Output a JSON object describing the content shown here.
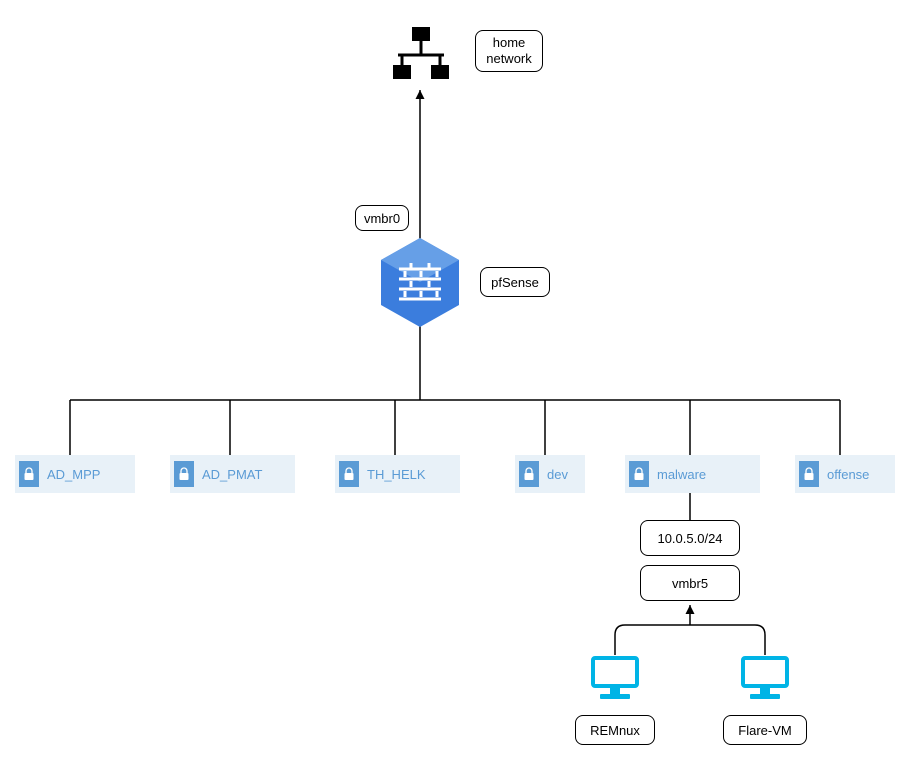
{
  "top": {
    "home_network": "home\nnetwork",
    "bridge0": "vmbr0",
    "firewall": "pfSense"
  },
  "networks": [
    {
      "label": "AD_MPP"
    },
    {
      "label": "AD_PMAT"
    },
    {
      "label": "TH_HELK"
    },
    {
      "label": "dev"
    },
    {
      "label": "malware"
    },
    {
      "label": "offense"
    }
  ],
  "malware_detail": {
    "subnet": "10.0.5.0/24",
    "bridge": "vmbr5",
    "vm1": "REMnux",
    "vm2": "Flare-VM"
  },
  "colors": {
    "accent": "#5a9bd5",
    "hexagon": "#3b7ddd",
    "hexagon_top": "#669fe7",
    "monitor": "#00b4e6",
    "net_bg": "#e8f1f8"
  }
}
